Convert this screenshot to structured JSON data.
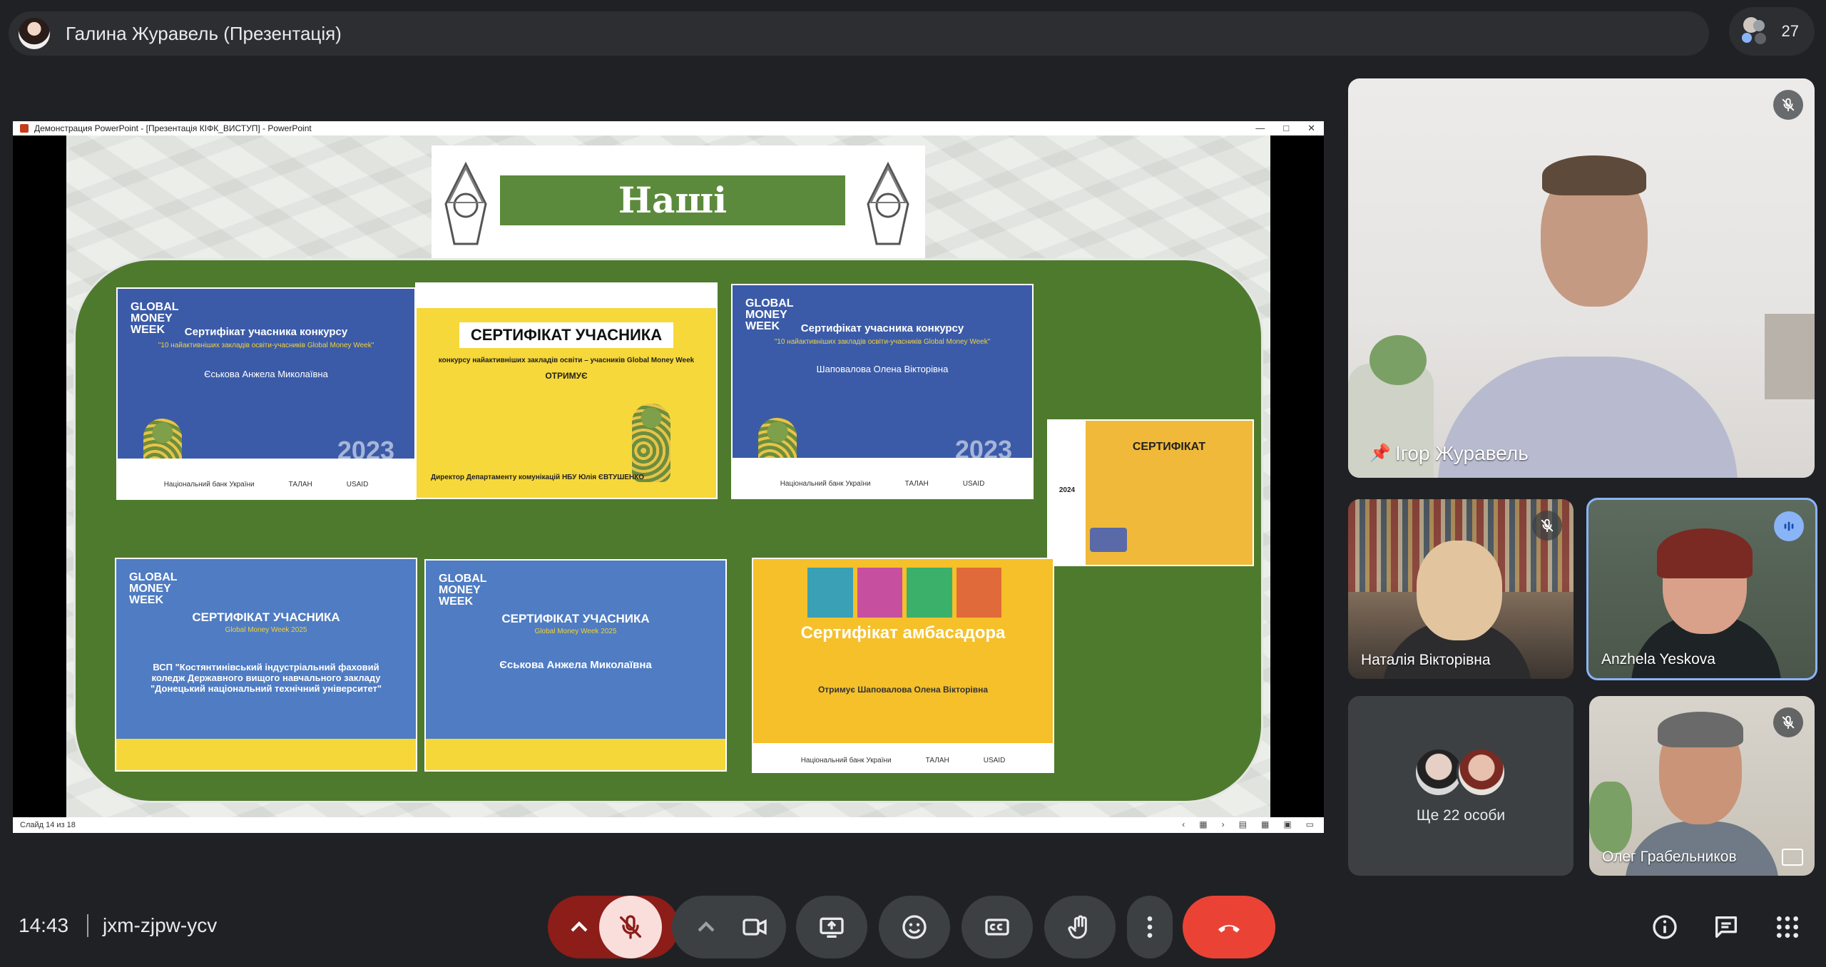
{
  "presenter_bar": {
    "title": "Галина Журавель (Презентація)"
  },
  "participants": {
    "count": "27"
  },
  "ppt": {
    "window_title": "Демонстрация PowerPoint - [Презентація КІФК_ВИСТУП] - PowerPoint",
    "status": "Слайд 14 из 18",
    "slide_title": "Наші досягнення",
    "certificates": [
      {
        "title": "Сертифікат учасника конкурсу",
        "subtitle": "\"10 найактивніших закладів освіти-учасників Global Money Week\"",
        "name": "Єськова Анжела Миколаївна",
        "year": "2023"
      },
      {
        "title": "СЕРТИФІКАТ УЧАСНИКА",
        "subtitle": "конкурсу найактивніших закладів освіти – учасників Global Money Week",
        "name": "ОТРИМУЄ",
        "sign": "Директор Департаменту комунікацій НБУ  Юлія ЄВТУШЕНКО"
      },
      {
        "title": "Сертифікат учасника конкурсу",
        "subtitle": "\"10 найактивніших закладів освіти-учасників Global Money Week\"",
        "name": "Шаповалова Олена Вікторівна",
        "year": "2023"
      },
      {
        "title": "СЕРТИФІКАТ",
        "year": "2024"
      },
      {
        "title": "СЕРТИФІКАТ УЧАСНИКА",
        "subtitle": "Global Money Week 2025",
        "name": "ВСП \"Костянтинівський індустріальний фаховий коледж Державного вищого навчального закладу \"Донецький національний технічний університет\""
      },
      {
        "title": "СЕРТИФІКАТ УЧАСНИКА",
        "subtitle": "Global Money Week 2025",
        "name": "Єськова Анжела Миколаївна"
      },
      {
        "title": "Сертифікат амбасадора",
        "name": "Отримує Шаповалова Олена Вікторівна"
      }
    ],
    "logos": [
      "Національний банк України",
      "ТАЛАН",
      "USAID"
    ]
  },
  "tiles": {
    "main": "Ігор Журавель",
    "t1": "Наталія Вікторівна",
    "t2": "Anzhela Yeskova",
    "t3": "Ще 22 особи",
    "t4": "Олег Грабельников"
  },
  "bottom": {
    "time": "14:43",
    "meeting_code": "jxm-zjpw-ycv"
  },
  "colors": {
    "end_call": "#ea4335",
    "muted_bg": "#f9dedc",
    "muted_outer": "#8c1d18",
    "control_bg": "#3c4043"
  }
}
